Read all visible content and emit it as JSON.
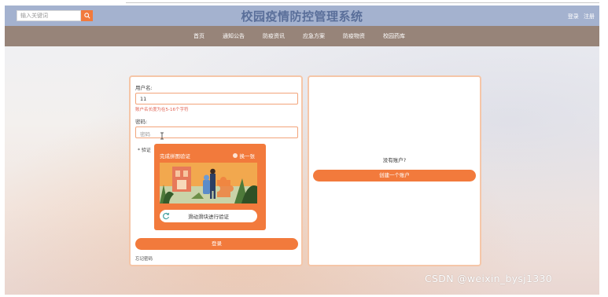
{
  "header": {
    "search_placeholder": "输入关键词",
    "title": "校园疫情防控管理系统",
    "login": "登录",
    "register": "注册"
  },
  "nav": {
    "items": [
      "首页",
      "通知公告",
      "防疫资讯",
      "应急方案",
      "防疫物资",
      "校园药库"
    ]
  },
  "login_form": {
    "username_label": "用户名:",
    "username_value": "11",
    "username_hint": "账户名长度为在5-16个字符",
    "password_label": "密码:",
    "password_placeholder": "密码",
    "verify_label": "* 验证",
    "captcha": {
      "title": "完成拼图验证",
      "refresh": "换一张",
      "slider_text": "滑动滑块进行验证"
    },
    "submit": "登录",
    "forgot": "忘记密码"
  },
  "register_panel": {
    "prompt": "没有账户?",
    "create_button": "创建一个账户"
  },
  "watermark": "CSDN @weixin_bysj1330",
  "colors": {
    "accent": "#f27a3c",
    "header_bg": "#a4b2cf",
    "nav_bg": "#978479",
    "title": "#5a6f9a"
  }
}
